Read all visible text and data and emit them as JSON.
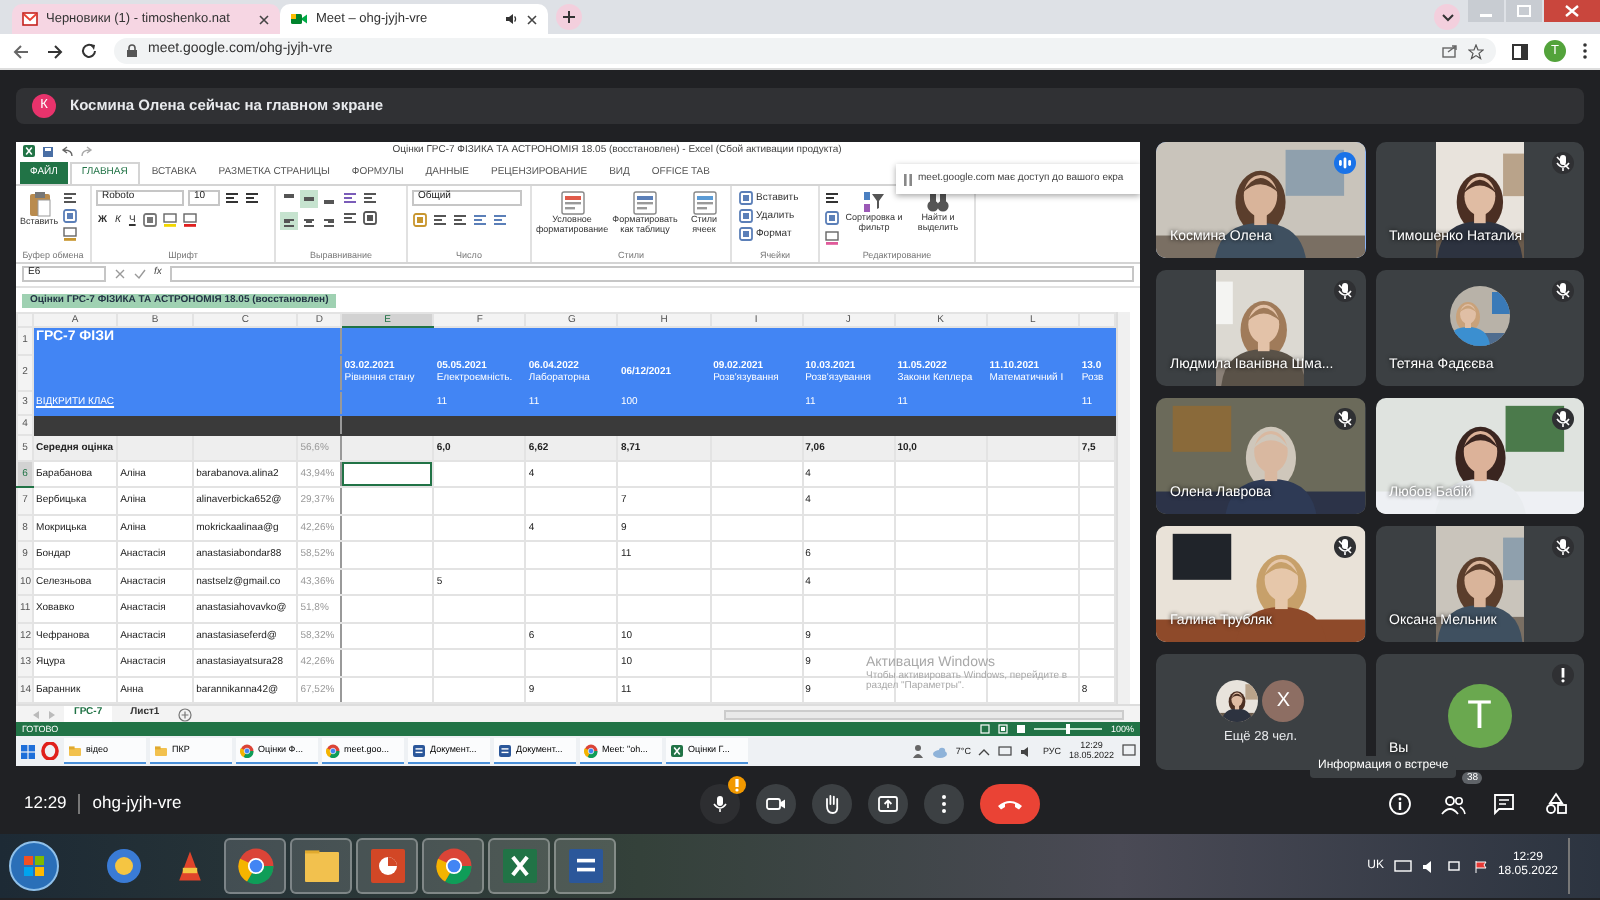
{
  "browser": {
    "tabs": [
      {
        "kind": "mail",
        "title": "Черновики (1) - timoshenko.nat",
        "selected": false,
        "audio": false
      },
      {
        "kind": "meet",
        "title": "Meet – ohg-jyjh-vre",
        "selected": true,
        "audio": true
      }
    ],
    "address": "meet.google.com/ohg-jyjh-vre",
    "profile": "T"
  },
  "meet": {
    "banner": {
      "initial": "К",
      "text": "Космина Олена сейчас на главном экране"
    },
    "excel": {
      "title": "Оцінки ГРС-7 ФІЗИКА ТА АСТРОНОМІЯ  18.05 (восстановлен) - Excel (Сбой активации продукта)",
      "tabs": [
        {
          "label": "ФАЙЛ",
          "kind": "file",
          "selected": false
        },
        {
          "label": "ГЛАВНАЯ",
          "kind": "tab",
          "selected": true
        },
        {
          "label": "ВСТАВКА",
          "kind": "tab",
          "selected": false
        },
        {
          "label": "РАЗМЕТКА СТРАНИЦЫ",
          "kind": "tab",
          "selected": false
        },
        {
          "label": "ФОРМУЛЫ",
          "kind": "tab",
          "selected": false
        },
        {
          "label": "ДАННЫЕ",
          "kind": "tab",
          "selected": false
        },
        {
          "label": "РЕЦЕНЗИРОВАНИЕ",
          "kind": "tab",
          "selected": false
        },
        {
          "label": "ВИД",
          "kind": "tab",
          "selected": false
        },
        {
          "label": "OFFICE TAB",
          "kind": "tab",
          "selected": false
        }
      ],
      "ribbon": {
        "paste": "Вставить",
        "font": "Roboto",
        "font_size": "10",
        "bold": "Ж",
        "italic": "К",
        "underline": "Ч",
        "number_format": "Общий",
        "alignment": [
          {
            "kind": "top",
            "selected": false
          },
          {
            "kind": "middle",
            "selected": true
          },
          {
            "kind": "bottom",
            "selected": false
          },
          {
            "kind": "left",
            "selected": true
          },
          {
            "kind": "center",
            "selected": false
          },
          {
            "kind": "right",
            "selected": false
          }
        ],
        "styles": [
          "Условное форматирование",
          "Форматировать как таблицу",
          "Стили ячеек"
        ],
        "cells": [
          "Вставить",
          "Удалить",
          "Формат"
        ],
        "editing": [
          "Сортировка и фильтр",
          "Найти и выделить"
        ],
        "groups": [
          "Буфер обмена",
          "Шрифт",
          "Выравнивание",
          "Число",
          "Стили",
          "Ячейки",
          "Редактирование"
        ]
      },
      "share_notice": "meet.google.com має доступ до вашого екра",
      "name_box": "E6",
      "fx": "fx",
      "document_tab": "Оцінки ГРС-7 ФІЗИКА ТА АСТРОНОМІЯ  18.05 (восстановлен)",
      "columns": [
        "A",
        "B",
        "C",
        "D",
        "E",
        "F",
        "G",
        "H",
        "I",
        "J",
        "K",
        "L"
      ],
      "rows": [
        {
          "number": "1",
          "kind": "title",
          "cells": [
            "ГРС-7 ФІЗИ"
          ]
        },
        {
          "number": "2",
          "kind": "header",
          "cells": [
            null,
            null,
            null,
            null,
            {
              "date": "03.02.2021",
              "topic": "Рівняння стану"
            },
            {
              "date": "05.05.2021",
              "topic": "Електроємність."
            },
            {
              "date": "06.04.2022",
              "topic": "Лабораторна"
            },
            {
              "date": "06/12/2021"
            },
            {
              "date": "09.02.2021",
              "topic": "Розв'язування"
            },
            {
              "date": "10.03.2021",
              "topic": "Розв'язування"
            },
            {
              "date": "11.05.2022",
              "topic": "Закони Кеплера"
            },
            {
              "date": "11.10.2021",
              "topic": "Математичний І"
            },
            {
              "date": "13.0",
              "topic": "Розв"
            }
          ]
        },
        {
          "number": "3",
          "kind": "link",
          "cells": [
            "ВІДКРИТИ КЛАС",
            null,
            null,
            null,
            null,
            "11",
            "11",
            "100",
            null,
            "11",
            "11",
            null,
            "11"
          ]
        },
        {
          "number": "4",
          "kind": "band"
        },
        {
          "number": "5",
          "kind": "average",
          "cells": [
            "Середня оцінка",
            null,
            null,
            "56,6%",
            null,
            "6,0",
            "6,62",
            "8,71",
            null,
            "7,06",
            "10,0",
            null,
            "7,5"
          ]
        },
        {
          "number": "6",
          "kind": "student",
          "cells": [
            "Барабанова",
            "Аліна",
            "barabanova.alina2",
            "43,94%",
            {
              "selected": true
            },
            null,
            "4",
            null,
            null,
            "4"
          ]
        },
        {
          "number": "7",
          "kind": "student",
          "cells": [
            "Вербицька",
            "Аліна",
            "alinaverbicka652@",
            "29,37%",
            null,
            null,
            null,
            "7",
            null,
            "4"
          ]
        },
        {
          "number": "8",
          "kind": "student",
          "cells": [
            "Мокрицька",
            "Аліна",
            "mokrickaalinaa@g",
            "42,26%",
            null,
            null,
            "4",
            "9"
          ]
        },
        {
          "number": "9",
          "kind": "student",
          "cells": [
            "Бондар",
            "Анастасія",
            "anastasiabondar88",
            "58,52%",
            null,
            null,
            null,
            "11",
            null,
            "6"
          ]
        },
        {
          "number": "10",
          "kind": "student",
          "cells": [
            "Селезньова",
            "Анастасія",
            "nastselz@gmail.co",
            "43,36%",
            null,
            "5",
            null,
            null,
            null,
            "4"
          ]
        },
        {
          "number": "11",
          "kind": "student",
          "cells": [
            "Ховавко",
            "Анастасія",
            "anastasiahovavko@",
            "51,8%"
          ]
        },
        {
          "number": "12",
          "kind": "student",
          "cells": [
            "Чефранова",
            "Анастасія",
            "anastasiaseferd@",
            "58,32%",
            null,
            null,
            "6",
            "10",
            null,
            "9"
          ]
        },
        {
          "number": "13",
          "kind": "student",
          "cells": [
            "Яцура",
            "Анастасія",
            "anastasiayatsura28",
            "42,26%",
            null,
            null,
            null,
            "10",
            null,
            "9"
          ]
        },
        {
          "number": "14",
          "kind": "student",
          "cells": [
            "Баранник",
            "Анна",
            "barannikanna42@",
            "67,52%",
            null,
            null,
            "9",
            "11",
            null,
            "9",
            null,
            null,
            "8"
          ]
        }
      ],
      "activation": {
        "title": "Активация Windows",
        "text": "Чтобы активировать Windows, перейдите в раздел \"Параметры\"."
      },
      "sheets": [
        {
          "label": "ГРС-7",
          "selected": true
        },
        {
          "label": "Лист1",
          "selected": false
        }
      ],
      "status": "ГОТОВО",
      "zoom": "100%",
      "zoom_slider": {
        "level": 0.5
      },
      "taskbar": {
        "items": [
          {
            "kind": "folder",
            "label": "відео"
          },
          {
            "kind": "folder",
            "label": "ПКР"
          },
          {
            "kind": "chrome",
            "label": "Оцінки Ф..."
          },
          {
            "kind": "chrome",
            "label": "meet.goo..."
          },
          {
            "kind": "word",
            "label": "Документ..."
          },
          {
            "kind": "word",
            "label": "Документ..."
          },
          {
            "kind": "chrome",
            "label": "Meet: \"oh..."
          },
          {
            "kind": "excel",
            "label": "Оцінки Г..."
          }
        ],
        "weather": "7°C",
        "language": "РУС",
        "time": "12:29",
        "date": "18.05.2022"
      }
    },
    "tiles": [
      {
        "kind": "video",
        "name": "Космина Олена",
        "speaking": true,
        "muted": false
      },
      {
        "kind": "portrait",
        "name": "Тимошенко Наталия",
        "speaking": false,
        "muted": true
      },
      {
        "kind": "portrait",
        "name": "Людмила Іванівна Шма...",
        "speaking": false,
        "muted": true
      },
      {
        "kind": "avatar",
        "name": "Тетяна Фадєєва",
        "speaking": false,
        "muted": true
      },
      {
        "kind": "video",
        "name": "Олена Лаврова",
        "speaking": false,
        "muted": true
      },
      {
        "kind": "video",
        "name": "Любов Бабій",
        "speaking": false,
        "muted": true
      },
      {
        "kind": "video",
        "name": "Галина Трубляк",
        "speaking": false,
        "muted": true
      },
      {
        "kind": "portrait",
        "name": "Оксана Мельник",
        "speaking": false,
        "muted": true
      },
      {
        "kind": "more",
        "label": "Ещё 28 чел.",
        "initial": "X"
      },
      {
        "kind": "self",
        "name": "Вы",
        "initial": "T",
        "alert": true
      }
    ],
    "tooltip": "Информация о встрече",
    "bottom_bar": {
      "time": "12:29",
      "code": "ohg-jyjh-vre",
      "controls": [
        {
          "kind": "mic",
          "alert": true
        },
        {
          "kind": "camera"
        },
        {
          "kind": "hand"
        },
        {
          "kind": "present"
        },
        {
          "kind": "more"
        },
        {
          "kind": "hangup"
        }
      ],
      "side": [
        {
          "kind": "info"
        },
        {
          "kind": "people",
          "count": "38"
        },
        {
          "kind": "chat"
        },
        {
          "kind": "activities"
        }
      ]
    }
  },
  "taskbar": {
    "apps": [
      {
        "kind": "globe",
        "running": false
      },
      {
        "kind": "ccleaner",
        "running": false
      },
      {
        "kind": "chrome",
        "running": true
      },
      {
        "kind": "folder",
        "running": true
      },
      {
        "kind": "powerpoint",
        "running": true
      },
      {
        "kind": "chrome",
        "running": true
      },
      {
        "kind": "excel",
        "running": true
      },
      {
        "kind": "word",
        "running": true
      }
    ],
    "language": "UK",
    "time": "12:29",
    "date": "18.05.2022"
  }
}
